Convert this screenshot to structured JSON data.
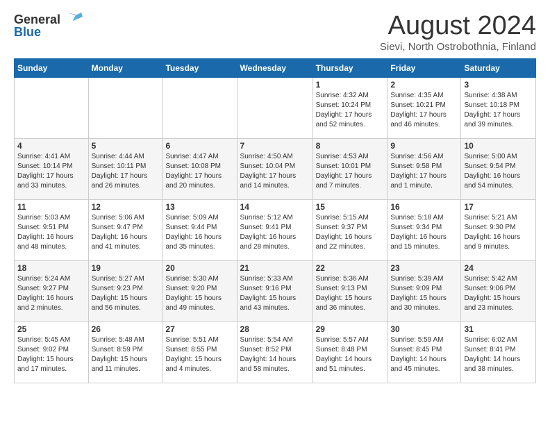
{
  "header": {
    "logo": {
      "general": "General",
      "blue": "Blue"
    },
    "title": "August 2024",
    "location": "Sievi, North Ostrobothnia, Finland"
  },
  "days_of_week": [
    "Sunday",
    "Monday",
    "Tuesday",
    "Wednesday",
    "Thursday",
    "Friday",
    "Saturday"
  ],
  "weeks": [
    [
      {
        "day": "",
        "info": ""
      },
      {
        "day": "",
        "info": ""
      },
      {
        "day": "",
        "info": ""
      },
      {
        "day": "",
        "info": ""
      },
      {
        "day": "1",
        "info": "Sunrise: 4:32 AM\nSunset: 10:24 PM\nDaylight: 17 hours and 52 minutes."
      },
      {
        "day": "2",
        "info": "Sunrise: 4:35 AM\nSunset: 10:21 PM\nDaylight: 17 hours and 46 minutes."
      },
      {
        "day": "3",
        "info": "Sunrise: 4:38 AM\nSunset: 10:18 PM\nDaylight: 17 hours and 39 minutes."
      }
    ],
    [
      {
        "day": "4",
        "info": "Sunrise: 4:41 AM\nSunset: 10:14 PM\nDaylight: 17 hours and 33 minutes."
      },
      {
        "day": "5",
        "info": "Sunrise: 4:44 AM\nSunset: 10:11 PM\nDaylight: 17 hours and 26 minutes."
      },
      {
        "day": "6",
        "info": "Sunrise: 4:47 AM\nSunset: 10:08 PM\nDaylight: 17 hours and 20 minutes."
      },
      {
        "day": "7",
        "info": "Sunrise: 4:50 AM\nSunset: 10:04 PM\nDaylight: 17 hours and 14 minutes."
      },
      {
        "day": "8",
        "info": "Sunrise: 4:53 AM\nSunset: 10:01 PM\nDaylight: 17 hours and 7 minutes."
      },
      {
        "day": "9",
        "info": "Sunrise: 4:56 AM\nSunset: 9:58 PM\nDaylight: 17 hours and 1 minute."
      },
      {
        "day": "10",
        "info": "Sunrise: 5:00 AM\nSunset: 9:54 PM\nDaylight: 16 hours and 54 minutes."
      }
    ],
    [
      {
        "day": "11",
        "info": "Sunrise: 5:03 AM\nSunset: 9:51 PM\nDaylight: 16 hours and 48 minutes."
      },
      {
        "day": "12",
        "info": "Sunrise: 5:06 AM\nSunset: 9:47 PM\nDaylight: 16 hours and 41 minutes."
      },
      {
        "day": "13",
        "info": "Sunrise: 5:09 AM\nSunset: 9:44 PM\nDaylight: 16 hours and 35 minutes."
      },
      {
        "day": "14",
        "info": "Sunrise: 5:12 AM\nSunset: 9:41 PM\nDaylight: 16 hours and 28 minutes."
      },
      {
        "day": "15",
        "info": "Sunrise: 5:15 AM\nSunset: 9:37 PM\nDaylight: 16 hours and 22 minutes."
      },
      {
        "day": "16",
        "info": "Sunrise: 5:18 AM\nSunset: 9:34 PM\nDaylight: 16 hours and 15 minutes."
      },
      {
        "day": "17",
        "info": "Sunrise: 5:21 AM\nSunset: 9:30 PM\nDaylight: 16 hours and 9 minutes."
      }
    ],
    [
      {
        "day": "18",
        "info": "Sunrise: 5:24 AM\nSunset: 9:27 PM\nDaylight: 16 hours and 2 minutes."
      },
      {
        "day": "19",
        "info": "Sunrise: 5:27 AM\nSunset: 9:23 PM\nDaylight: 15 hours and 56 minutes."
      },
      {
        "day": "20",
        "info": "Sunrise: 5:30 AM\nSunset: 9:20 PM\nDaylight: 15 hours and 49 minutes."
      },
      {
        "day": "21",
        "info": "Sunrise: 5:33 AM\nSunset: 9:16 PM\nDaylight: 15 hours and 43 minutes."
      },
      {
        "day": "22",
        "info": "Sunrise: 5:36 AM\nSunset: 9:13 PM\nDaylight: 15 hours and 36 minutes."
      },
      {
        "day": "23",
        "info": "Sunrise: 5:39 AM\nSunset: 9:09 PM\nDaylight: 15 hours and 30 minutes."
      },
      {
        "day": "24",
        "info": "Sunrise: 5:42 AM\nSunset: 9:06 PM\nDaylight: 15 hours and 23 minutes."
      }
    ],
    [
      {
        "day": "25",
        "info": "Sunrise: 5:45 AM\nSunset: 9:02 PM\nDaylight: 15 hours and 17 minutes."
      },
      {
        "day": "26",
        "info": "Sunrise: 5:48 AM\nSunset: 8:59 PM\nDaylight: 15 hours and 11 minutes."
      },
      {
        "day": "27",
        "info": "Sunrise: 5:51 AM\nSunset: 8:55 PM\nDaylight: 15 hours and 4 minutes."
      },
      {
        "day": "28",
        "info": "Sunrise: 5:54 AM\nSunset: 8:52 PM\nDaylight: 14 hours and 58 minutes."
      },
      {
        "day": "29",
        "info": "Sunrise: 5:57 AM\nSunset: 8:48 PM\nDaylight: 14 hours and 51 minutes."
      },
      {
        "day": "30",
        "info": "Sunrise: 5:59 AM\nSunset: 8:45 PM\nDaylight: 14 hours and 45 minutes."
      },
      {
        "day": "31",
        "info": "Sunrise: 6:02 AM\nSunset: 8:41 PM\nDaylight: 14 hours and 38 minutes."
      }
    ]
  ]
}
